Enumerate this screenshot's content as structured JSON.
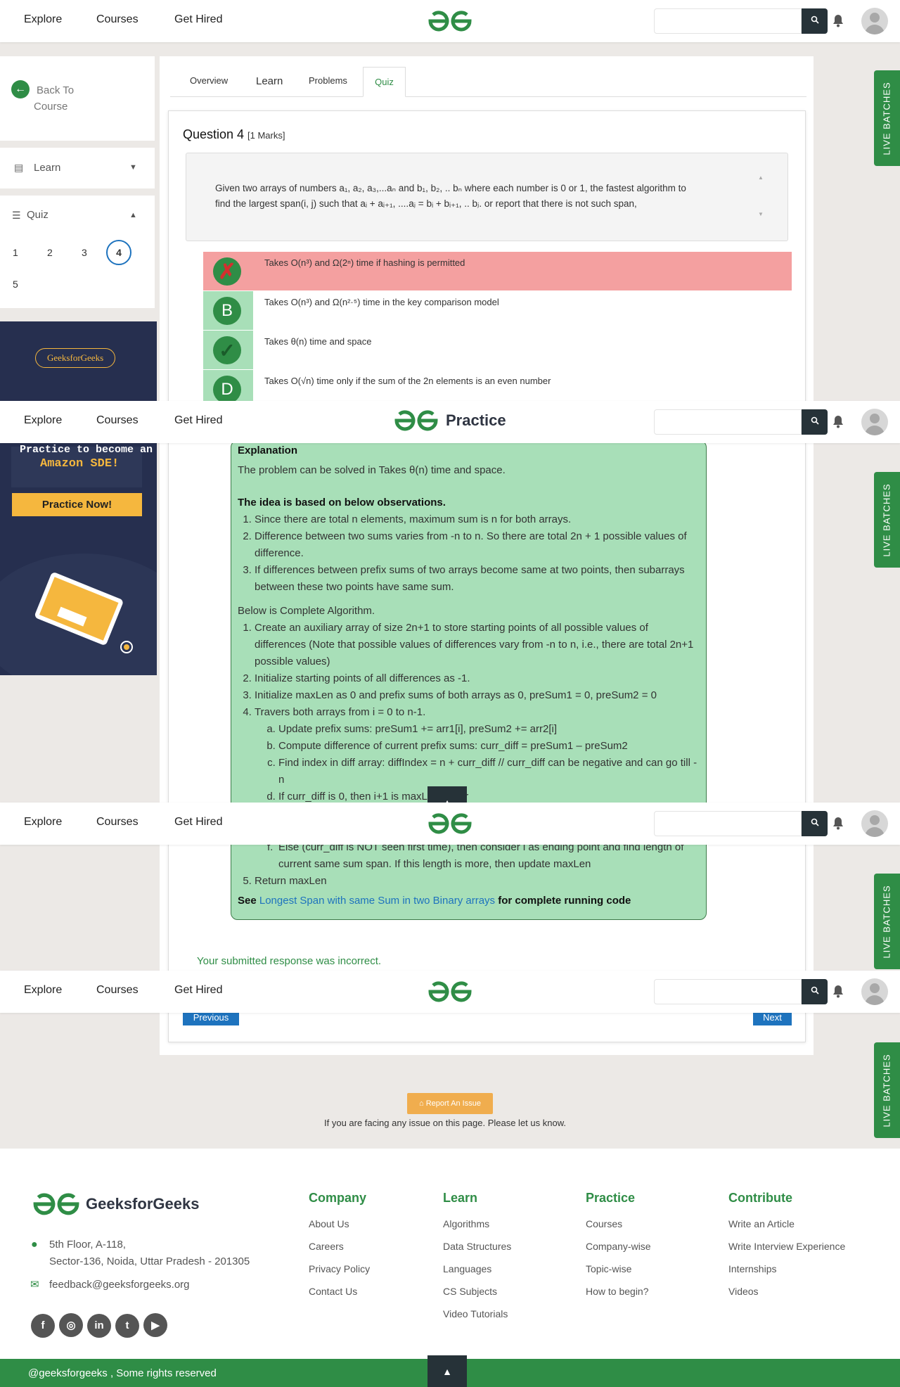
{
  "header": {
    "nav": [
      "Explore",
      "Courses",
      "Get Hired"
    ],
    "practice_label": "Practice"
  },
  "live_batches": "LIVE BATCHES",
  "sidebar": {
    "back_label_1": "Back To",
    "back_label_2": "Course",
    "learn_label": "Learn",
    "quiz_label": "Quiz",
    "quiz_numbers": [
      "1",
      "2",
      "3",
      "4",
      "5"
    ],
    "ad_brand": "GeeksforGeeks",
    "ad_heading_1": "Practice to become an",
    "ad_heading_2": "Amazon SDE!",
    "ad_button": "Practice Now!"
  },
  "tabs": [
    "Overview",
    "Learn",
    "Problems",
    "Quiz"
  ],
  "question": {
    "title": "Question 4",
    "marks": "[1 Marks]",
    "text_line1": "Given two arrays of numbers a₁, a₂, a₃,...aₙ and b₁, b₂, .. bₙ where each number is 0 or 1, the fastest algorithm to",
    "text_line2": "find the largest span(i, j) such that aᵢ + aᵢ₊₁, ....aⱼ = bᵢ + bᵢ₊₁, .. bⱼ. or report that there is not such span,"
  },
  "options": [
    {
      "badge": "✗",
      "text": "Takes O(n³) and Ω(2ⁿ) time if hashing is permitted"
    },
    {
      "badge": "B",
      "text": "Takes O(n³) and Ω(n²·⁵) time in the key comparison model"
    },
    {
      "badge": "✓",
      "text": "Takes θ(n) time and space"
    },
    {
      "badge": "D",
      "text": "Takes O(√n) time only if the sum of the 2n elements is an even number"
    }
  ],
  "explanation": {
    "heading": "Explanation",
    "intro": "The problem can be solved in  Takes θ(n) time and space.",
    "idea_heading": "The idea is based on below observations.",
    "obs": [
      "Since there are total n elements, maximum sum is n for both arrays.",
      "Difference between two sums varies from -n to n. So there are total 2n + 1 possible values of difference.",
      "If differences between prefix sums of two arrays become same at two points, then subarrays between these two points have same sum."
    ],
    "algo_heading": "Below is Complete Algorithm.",
    "algo": [
      "Create an auxiliary array of size 2n+1 to store starting points of all possible values of differences (Note that possible values of differences vary from -n to n, i.e., there are total 2n+1 possible values)",
      "Initialize starting points of all differences as -1.",
      "Initialize maxLen as 0 and prefix sums of both arrays as 0, preSum1 = 0, preSum2 = 0",
      "Travers both arrays from i = 0 to n-1."
    ],
    "sub": [
      "Update prefix sums: preSum1 += arr1[i], preSum2 += arr2[i]",
      "Compute difference of current prefix sums: curr_diff = preSum1 – preSum2",
      "Find index in diff array: diffIndex = n + curr_diff // curr_diff can be negative and can go till -n",
      "If curr_diff is 0, then i+1 is maxLen so far"
    ],
    "sub_f": "Else (curr_diff is NOT seen first time), then consider i as ending point and find length of current same sum span. If this length is more, then update maxLen",
    "return": "Return maxLen",
    "see_prefix": "See",
    "see_link": "Longest Span with same Sum in two Binary arrays",
    "see_suffix": "for complete running code"
  },
  "result_msg": "Your submitted response was incorrect.",
  "prev_label": "Previous",
  "next_label": "Next",
  "report": {
    "button": "Report An Issue",
    "note": "If you are facing any issue on this page. Please let us know."
  },
  "footer": {
    "brand": "GeeksforGeeks",
    "address1": "5th Floor, A-118,",
    "address2": "Sector-136, Noida, Uttar Pradesh - 201305",
    "email": "feedback@geeksforgeeks.org",
    "cols": [
      {
        "title": "Company",
        "links": [
          "About Us",
          "Careers",
          "Privacy Policy",
          "Contact Us"
        ]
      },
      {
        "title": "Learn",
        "links": [
          "Algorithms",
          "Data Structures",
          "Languages",
          "CS Subjects",
          "Video Tutorials"
        ]
      },
      {
        "title": "Practice",
        "links": [
          "Courses",
          "Company-wise",
          "Topic-wise",
          "How to begin?"
        ]
      },
      {
        "title": "Contribute",
        "links": [
          "Write an Article",
          "Write Interview Experience",
          "Internships",
          "Videos"
        ]
      }
    ],
    "copyright": "@geeksforgeeks , Some rights reserved"
  },
  "colors": {
    "brand": "#2f8d46",
    "wrong": "#f4a0a0",
    "explanation": "#a8dfb8",
    "link": "#1e73be"
  }
}
